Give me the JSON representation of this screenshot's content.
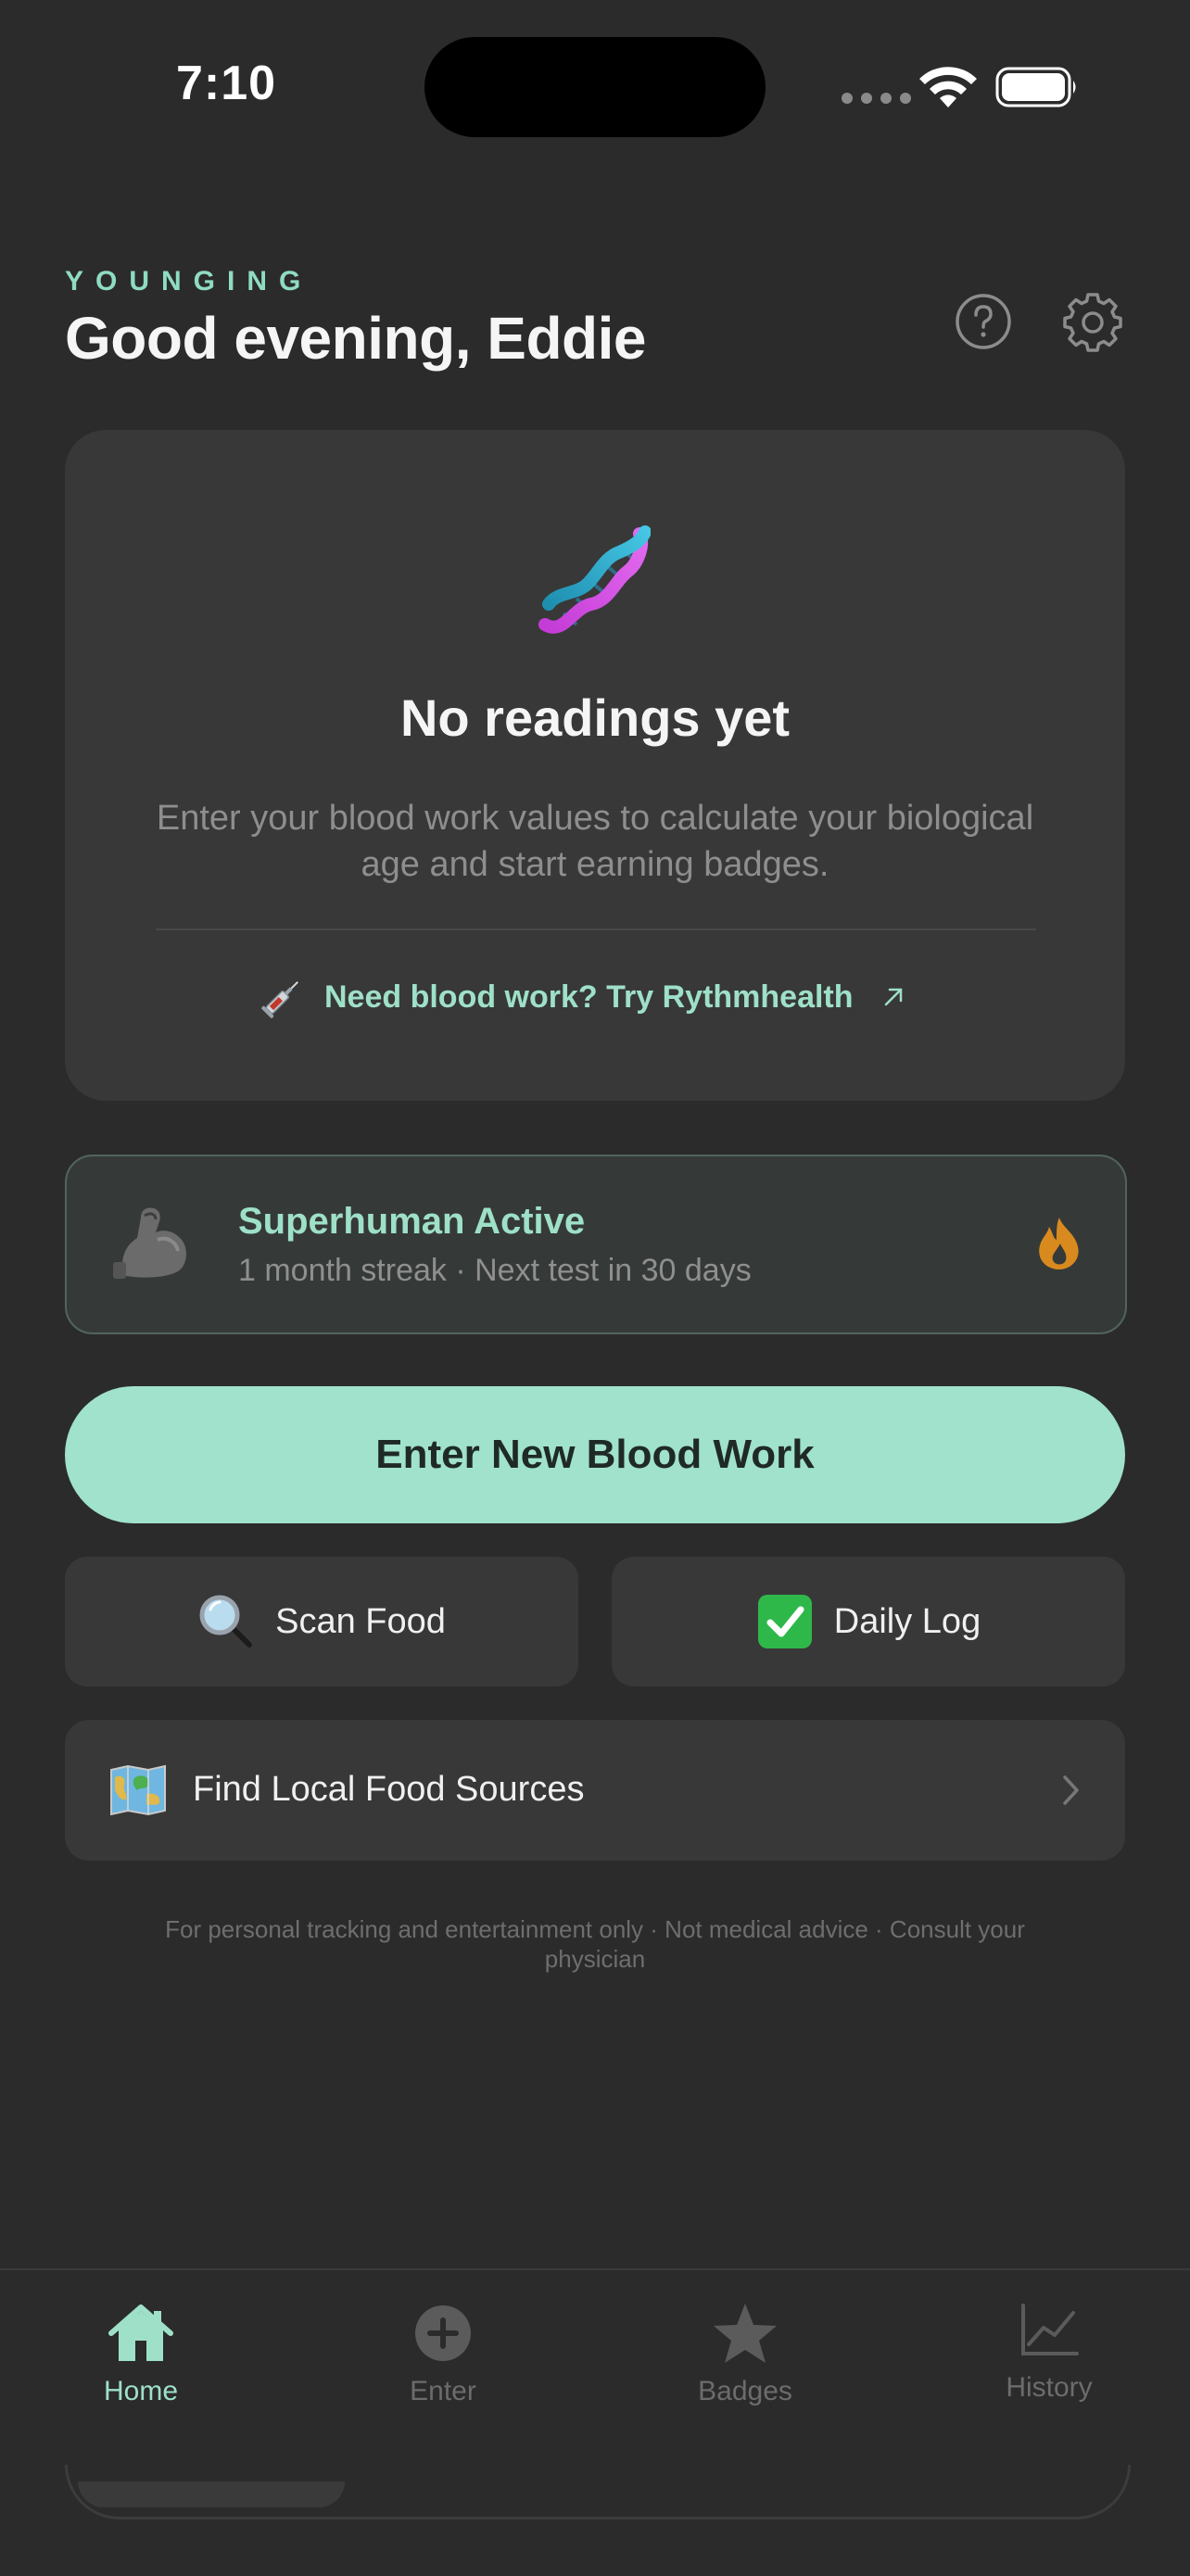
{
  "status_bar": {
    "time": "7:10"
  },
  "header": {
    "brand": "YOUNGING",
    "greeting": "Good evening, Eddie",
    "help_icon": "question-circle-icon",
    "settings_icon": "gear-icon"
  },
  "empty_state": {
    "icon": "dna-emoji-icon",
    "title": "No readings yet",
    "subtitle": "Enter your blood work values to calculate your biological age and start earning badges.",
    "link_icon": "syringe-emoji-icon",
    "link_label": "Need blood work? Try Rythmhealth",
    "link_arrow_icon": "external-arrow-icon"
  },
  "streak": {
    "icon": "flexed-bicep-emoji-icon",
    "title": "Superhuman Active",
    "subtitle": "1 month streak · Next test in 30 days",
    "badge_icon": "flame-icon"
  },
  "actions": {
    "primary_label": "Enter New Blood Work",
    "scan_icon": "magnifying-glass-emoji-icon",
    "scan_label": "Scan Food",
    "log_icon": "check-mark-button-emoji-icon",
    "log_label": "Daily Log",
    "find_icon": "world-map-emoji-icon",
    "find_label": "Find Local Food Sources"
  },
  "disclaimer": "For personal tracking and entertainment only · Not medical advice · Consult your physician",
  "tabbar": {
    "tabs": [
      {
        "label": "Home",
        "icon": "house-icon",
        "active": true
      },
      {
        "label": "Enter",
        "icon": "plus-circle-icon",
        "active": false
      },
      {
        "label": "Badges",
        "icon": "star-icon",
        "active": false
      },
      {
        "label": "History",
        "icon": "line-chart-icon",
        "active": false
      }
    ]
  },
  "colors": {
    "background": "#2b2b2b",
    "card": "#383838",
    "accent": "#9ee0c8",
    "primary_button": "#a0e2cb",
    "flame": "#d98a1e",
    "muted_text": "#8e8e8e"
  }
}
